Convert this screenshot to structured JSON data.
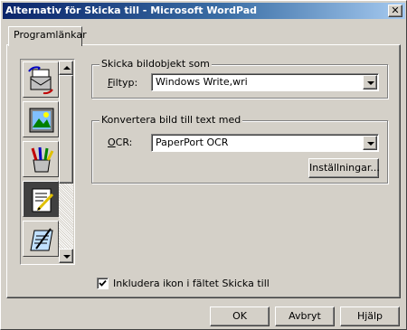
{
  "window": {
    "title": "Alternativ för Skicka till - Microsoft WordPad",
    "close_glyph": "✕"
  },
  "tabs": [
    {
      "label": "Programlänkar",
      "selected": true
    }
  ],
  "icon_list": {
    "items": [
      {
        "icon": "send-document-icon"
      },
      {
        "icon": "picture-icon"
      },
      {
        "icon": "paint-brushes-icon"
      },
      {
        "icon": "notepad-pen-icon",
        "selected": true
      },
      {
        "icon": "write-pad-icon"
      }
    ]
  },
  "save_image_group": {
    "label": "Skicka bildobjekt som",
    "file_type_label": "Filtyp:",
    "file_type_value": "Windows Write,wri"
  },
  "ocr_group": {
    "label": "Konvertera bild till text med",
    "ocr_label": "OCR:",
    "ocr_value": "PaperPort OCR",
    "settings_button": "Inställningar..."
  },
  "include_icon": {
    "label": "Inkludera ikon i fältet Skicka till",
    "checked": true
  },
  "buttons": {
    "ok": "OK",
    "cancel": "Avbryt",
    "help": "Hjälp"
  }
}
